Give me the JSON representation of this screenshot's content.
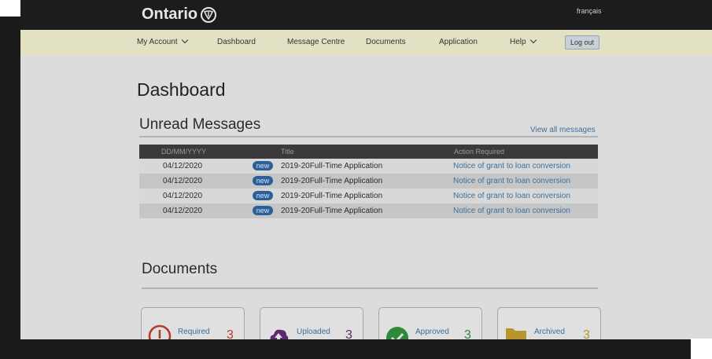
{
  "header": {
    "logo_text": "Ontario",
    "language_link": "français"
  },
  "nav": {
    "my_account": "My Account",
    "dashboard": "Dashboard",
    "message_centre": "Message Centre",
    "documents": "Documents",
    "application": "Application",
    "help": "Help",
    "logout": "Log out"
  },
  "page_title": "Dashboard",
  "unread": {
    "heading": "Unread Messages",
    "view_all": "View all messages",
    "columns": [
      "DD/MM/YYYY",
      "Title",
      "Action Required"
    ],
    "rows": [
      {
        "date": "04/12/2020",
        "badge": "new",
        "title": "2019-20Full-Time Application",
        "action": "Notice of grant to loan conversion"
      },
      {
        "date": "04/12/2020",
        "badge": "new",
        "title": "2019-20Full-Time Application",
        "action": "Notice of grant to loan conversion"
      },
      {
        "date": "04/12/2020",
        "badge": "new",
        "title": "2019-20Full-Time Application",
        "action": "Notice of grant to loan conversion"
      },
      {
        "date": "04/12/2020",
        "badge": "new",
        "title": "2019-20Full-Time Application",
        "action": "Notice of grant to loan conversion"
      }
    ]
  },
  "documents": {
    "heading": "Documents",
    "cards": [
      {
        "label": "Required",
        "count": "3",
        "color": "#b83a2a",
        "icon": "alert-circle-icon"
      },
      {
        "label": "Uploaded",
        "count": "3",
        "color": "#5b2a6e",
        "icon": "upload-cloud-icon"
      },
      {
        "label": "Approved",
        "count": "3",
        "color": "#2e8a3a",
        "icon": "check-circle-icon"
      },
      {
        "label": "Archived",
        "count": "3",
        "color": "#b9962d",
        "icon": "folder-icon"
      }
    ]
  }
}
